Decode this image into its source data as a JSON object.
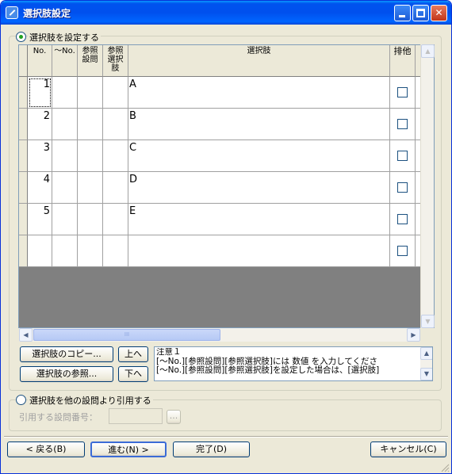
{
  "window": {
    "title": "選択肢設定"
  },
  "section1": {
    "radio_label": "選択肢を設定する",
    "selected": true
  },
  "grid": {
    "headers": {
      "no": "No.",
      "to": "〜No.",
      "ref_q_1": "参照",
      "ref_q_2": "設問",
      "ref_o_1": "参照",
      "ref_o_2": "選択",
      "ref_o_3": "肢",
      "option": "選択肢",
      "exclusive": "排他"
    },
    "rows": [
      {
        "no": "1",
        "option": "A",
        "exclusive": false
      },
      {
        "no": "2",
        "option": "B",
        "exclusive": false
      },
      {
        "no": "3",
        "option": "C",
        "exclusive": false
      },
      {
        "no": "4",
        "option": "D",
        "exclusive": false
      },
      {
        "no": "5",
        "option": "E",
        "exclusive": false
      },
      {
        "no": "",
        "option": "",
        "exclusive": false
      }
    ],
    "hscroll_thumb_glyph": "III"
  },
  "buttons": {
    "copy": "選択肢のコピー...",
    "up": "上へ",
    "reference": "選択肢の参照...",
    "down": "下へ"
  },
  "note": {
    "line1": "注意１",
    "line2": "[〜No.][参照設問][参照選択肢]には 数値 を入力してくださ",
    "line3": "[〜No.][参照設問][参照選択肢]を設定した場合は、[選択肢]"
  },
  "section2": {
    "radio_label": "選択肢を他の設問より引用する",
    "selected": false,
    "field_label": "引用する設問番号：",
    "browse_label": "..."
  },
  "footer": {
    "back": "< 戻る(B)",
    "next": "進む(N) >",
    "finish": "完了(D)",
    "cancel": "キャンセル(C)"
  }
}
